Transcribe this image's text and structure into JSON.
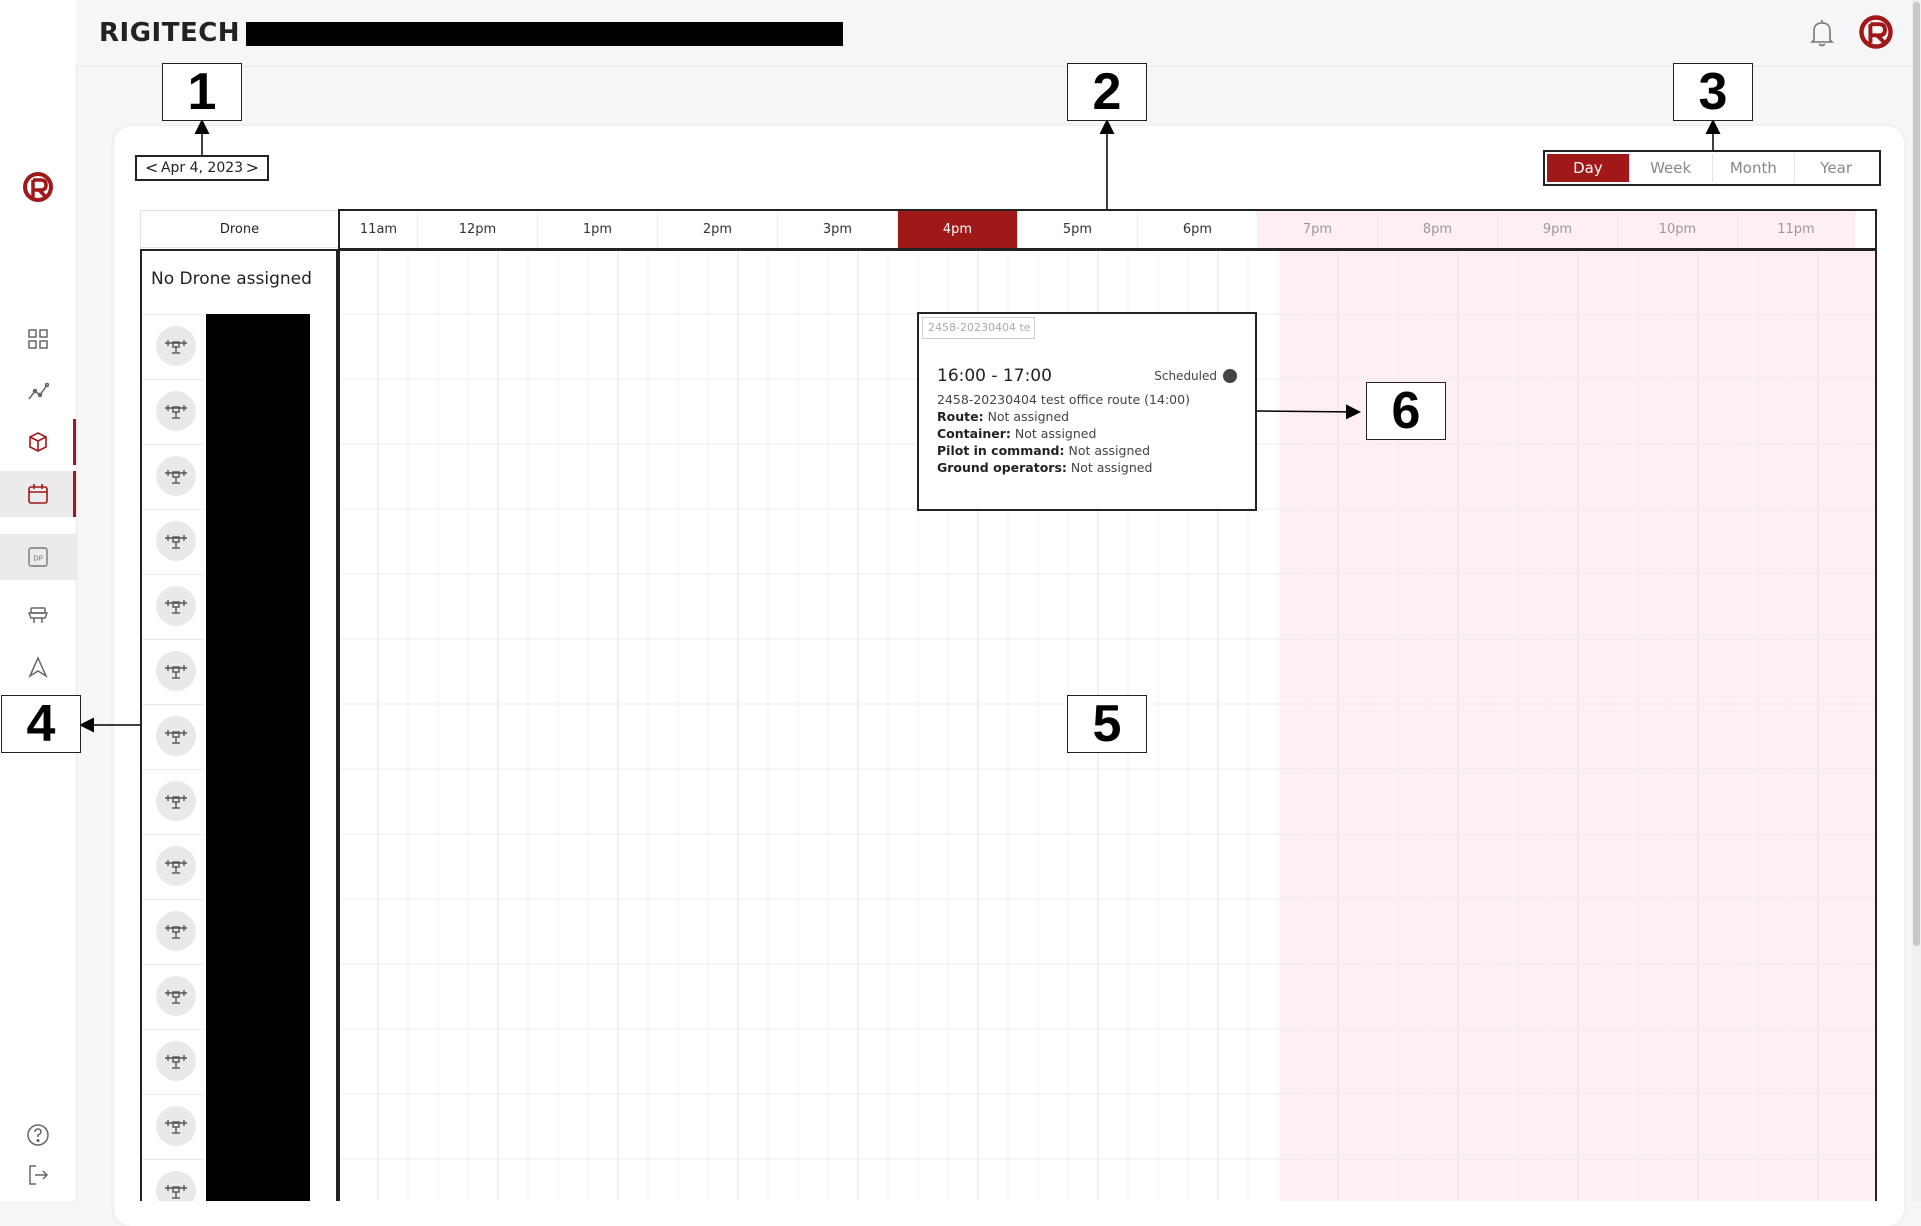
{
  "header": {
    "title": "RIGITECH -"
  },
  "date_nav": {
    "date": "Apr 4, 2023",
    "prev": "<",
    "next": ">"
  },
  "view_toggle": [
    "Day",
    "Week",
    "Month",
    "Year"
  ],
  "view_active": "Day",
  "grid": {
    "drone_column_label": "Drone",
    "hours": [
      "11am",
      "12pm",
      "1pm",
      "2pm",
      "3pm",
      "4pm",
      "5pm",
      "6pm",
      "7pm",
      "8pm",
      "9pm",
      "10pm",
      "11pm"
    ],
    "current_hour": "4pm",
    "no_drone_label": "No Drone assigned"
  },
  "popup": {
    "chip_text": "2458-20230404 te",
    "time": "16:00 - 17:00",
    "status": "Scheduled",
    "name": "2458-20230404 test office route (14:00)",
    "fields": [
      {
        "label": "Route:",
        "value": "Not assigned"
      },
      {
        "label": "Container:",
        "value": "Not assigned"
      },
      {
        "label": "Pilot in command:",
        "value": "Not assigned"
      },
      {
        "label": "Ground operators:",
        "value": "Not assigned"
      }
    ]
  },
  "callouts": [
    "1",
    "2",
    "3",
    "4",
    "5",
    "6"
  ],
  "icons": {
    "sidebar": [
      "logo-icon",
      "dashboard-icon",
      "analytics-icon",
      "cube-icon",
      "calendar-icon",
      "dp-icon",
      "drone-station-icon",
      "navigation-icon",
      "help-icon",
      "logout-icon"
    ],
    "header": [
      "bell-icon",
      "logo-icon"
    ]
  },
  "colors": {
    "accent": "#a11818",
    "after_hours": "#fdeff3"
  }
}
